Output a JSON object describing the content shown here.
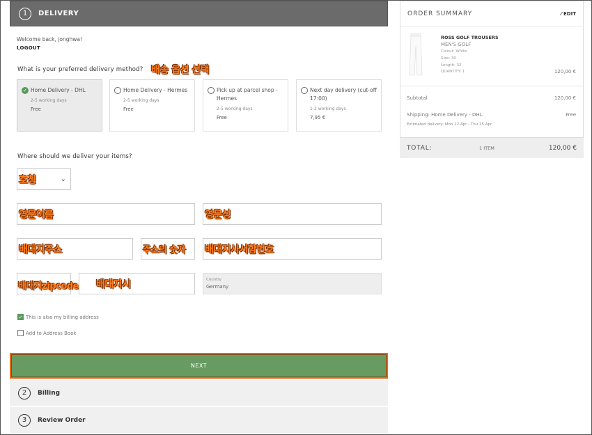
{
  "delivery": {
    "step": "1",
    "title": "DELIVERY"
  },
  "welcome": "Welcome back, jonghwa!",
  "logout": "LOGOUT",
  "method_question": "What is your preferred delivery method?",
  "method_annotation": "배송 옵션 선택",
  "options": [
    {
      "title": "Home Delivery - DHL",
      "days": "2-5 working days",
      "price": "Free",
      "selected": true
    },
    {
      "title": "Home Delivery - Hermes",
      "days": "2-5 working days",
      "price": "Free",
      "selected": false
    },
    {
      "title": "Pick up at parcel shop - Hermes",
      "days": "2-5 working days",
      "price": "Free",
      "selected": false
    },
    {
      "title": "Next day delivery (cut-off 17:00)",
      "days": "1-2 working days",
      "price": "7,95 €",
      "selected": false
    }
  ],
  "address_question": "Where should we deliver your items?",
  "fields": {
    "salutation": "호칭",
    "first_name": "영문이름",
    "last_name": "영문성",
    "street": "배대지주소",
    "house_number": "주소의 숫자",
    "suite": "배대지사서함번호",
    "zipcode": "배대지zipcode",
    "city": "배대지시",
    "country_label": "Country",
    "country_value": "Germany"
  },
  "billing_same_label": "This is also my billing address",
  "address_book_label": "Add to Address Book",
  "next_label": "NEXT",
  "steps": [
    {
      "num": "2",
      "title": "Billing"
    },
    {
      "num": "3",
      "title": "Review Order"
    }
  ],
  "summary": {
    "title": "ORDER SUMMARY",
    "edit": "EDIT",
    "product": {
      "name": "ROSS GOLF TROUSERS",
      "brand": "MEN'S GOLF",
      "colour": "Colour: White",
      "size": "Size: 30",
      "length": "Length: 32",
      "quantity": "QUANTITY: 1",
      "price": "120,00 €"
    },
    "subtotal_label": "Subtotal",
    "subtotal_value": "120,00 €",
    "shipping_label": "Shipping: Home Delivery - DHL",
    "shipping_value": "Free",
    "estimated": "Estimated delivery: Mon 12 Apr - Thu 15 Apr",
    "total_label": "TOTAL:",
    "total_items": "1 ITEM",
    "total_value": "120,00 €"
  },
  "colors": {
    "header": "#6b6b6b",
    "accent_green": "#679b61",
    "highlight_orange": "#ff7f1f"
  }
}
